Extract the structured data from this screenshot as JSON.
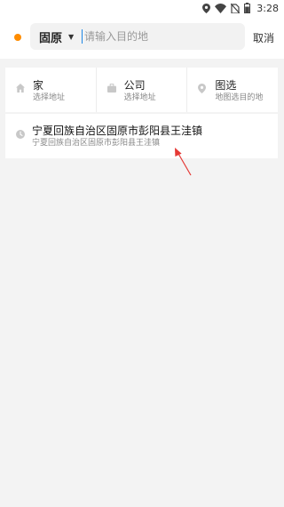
{
  "status_bar": {
    "time": "3:28"
  },
  "search": {
    "city": "固原",
    "placeholder": "请输入目的地",
    "cancel_label": "取消",
    "accent_color": "#ff8c00"
  },
  "quick_entries": [
    {
      "title": "家",
      "subtitle": "选择地址",
      "icon": "home-icon"
    },
    {
      "title": "公司",
      "subtitle": "选择地址",
      "icon": "briefcase-icon"
    },
    {
      "title": "图选",
      "subtitle": "地图选目的地",
      "icon": "location-pin-icon"
    }
  ],
  "history": [
    {
      "title": "宁夏回族自治区固原市彭阳县王洼镇",
      "subtitle": "宁夏回族自治区固原市彭阳县王洼镇",
      "icon": "clock-icon"
    }
  ],
  "annotation": {
    "color": "#e53935"
  }
}
